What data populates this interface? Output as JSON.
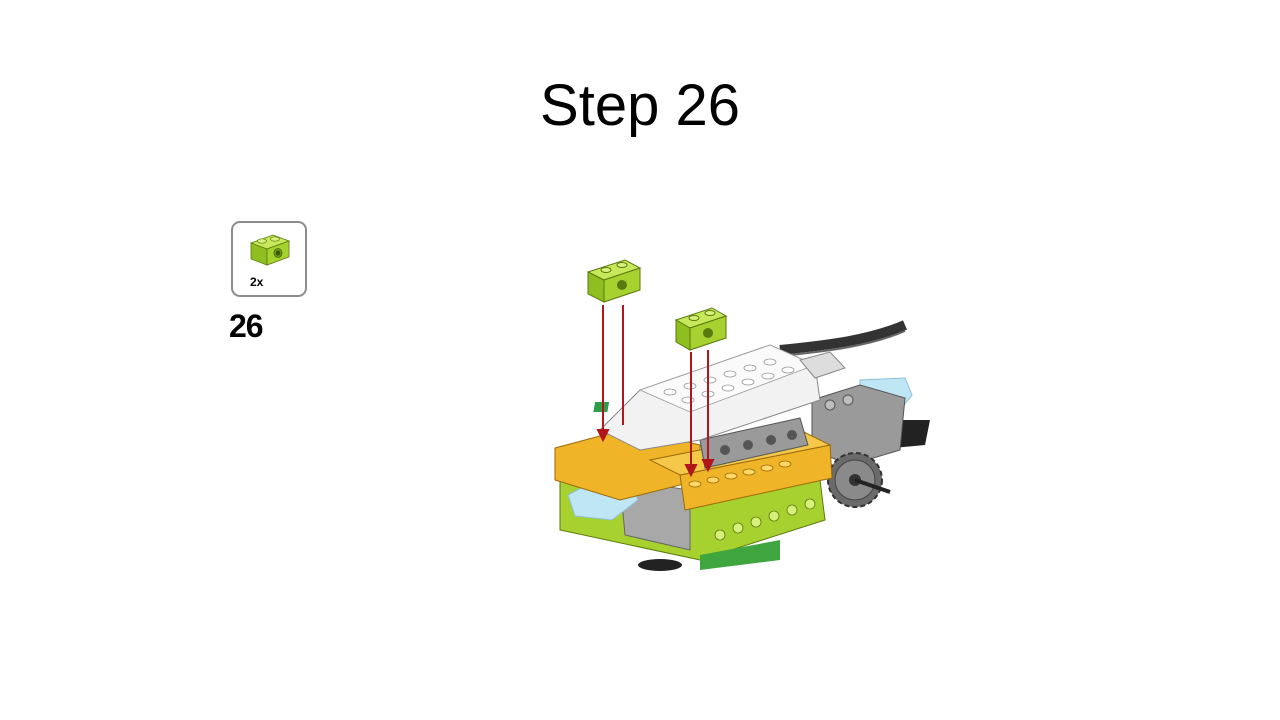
{
  "slide": {
    "title": "Step 26"
  },
  "parts_callout": {
    "quantity": "2x",
    "part_icon": "lime-technic-brick-1x2-icon",
    "part_color": "#a6d12e"
  },
  "step": {
    "number": "26"
  },
  "colors": {
    "lime": "#a6d12e",
    "yellow_orange": "#f0b429",
    "white_hub": "#f2f2f2",
    "gray": "#9a9a9a",
    "dark_gray": "#555555",
    "trans_light_blue": "#bfe6f5",
    "arrow_red": "#b0161a",
    "cable": "#333333"
  }
}
